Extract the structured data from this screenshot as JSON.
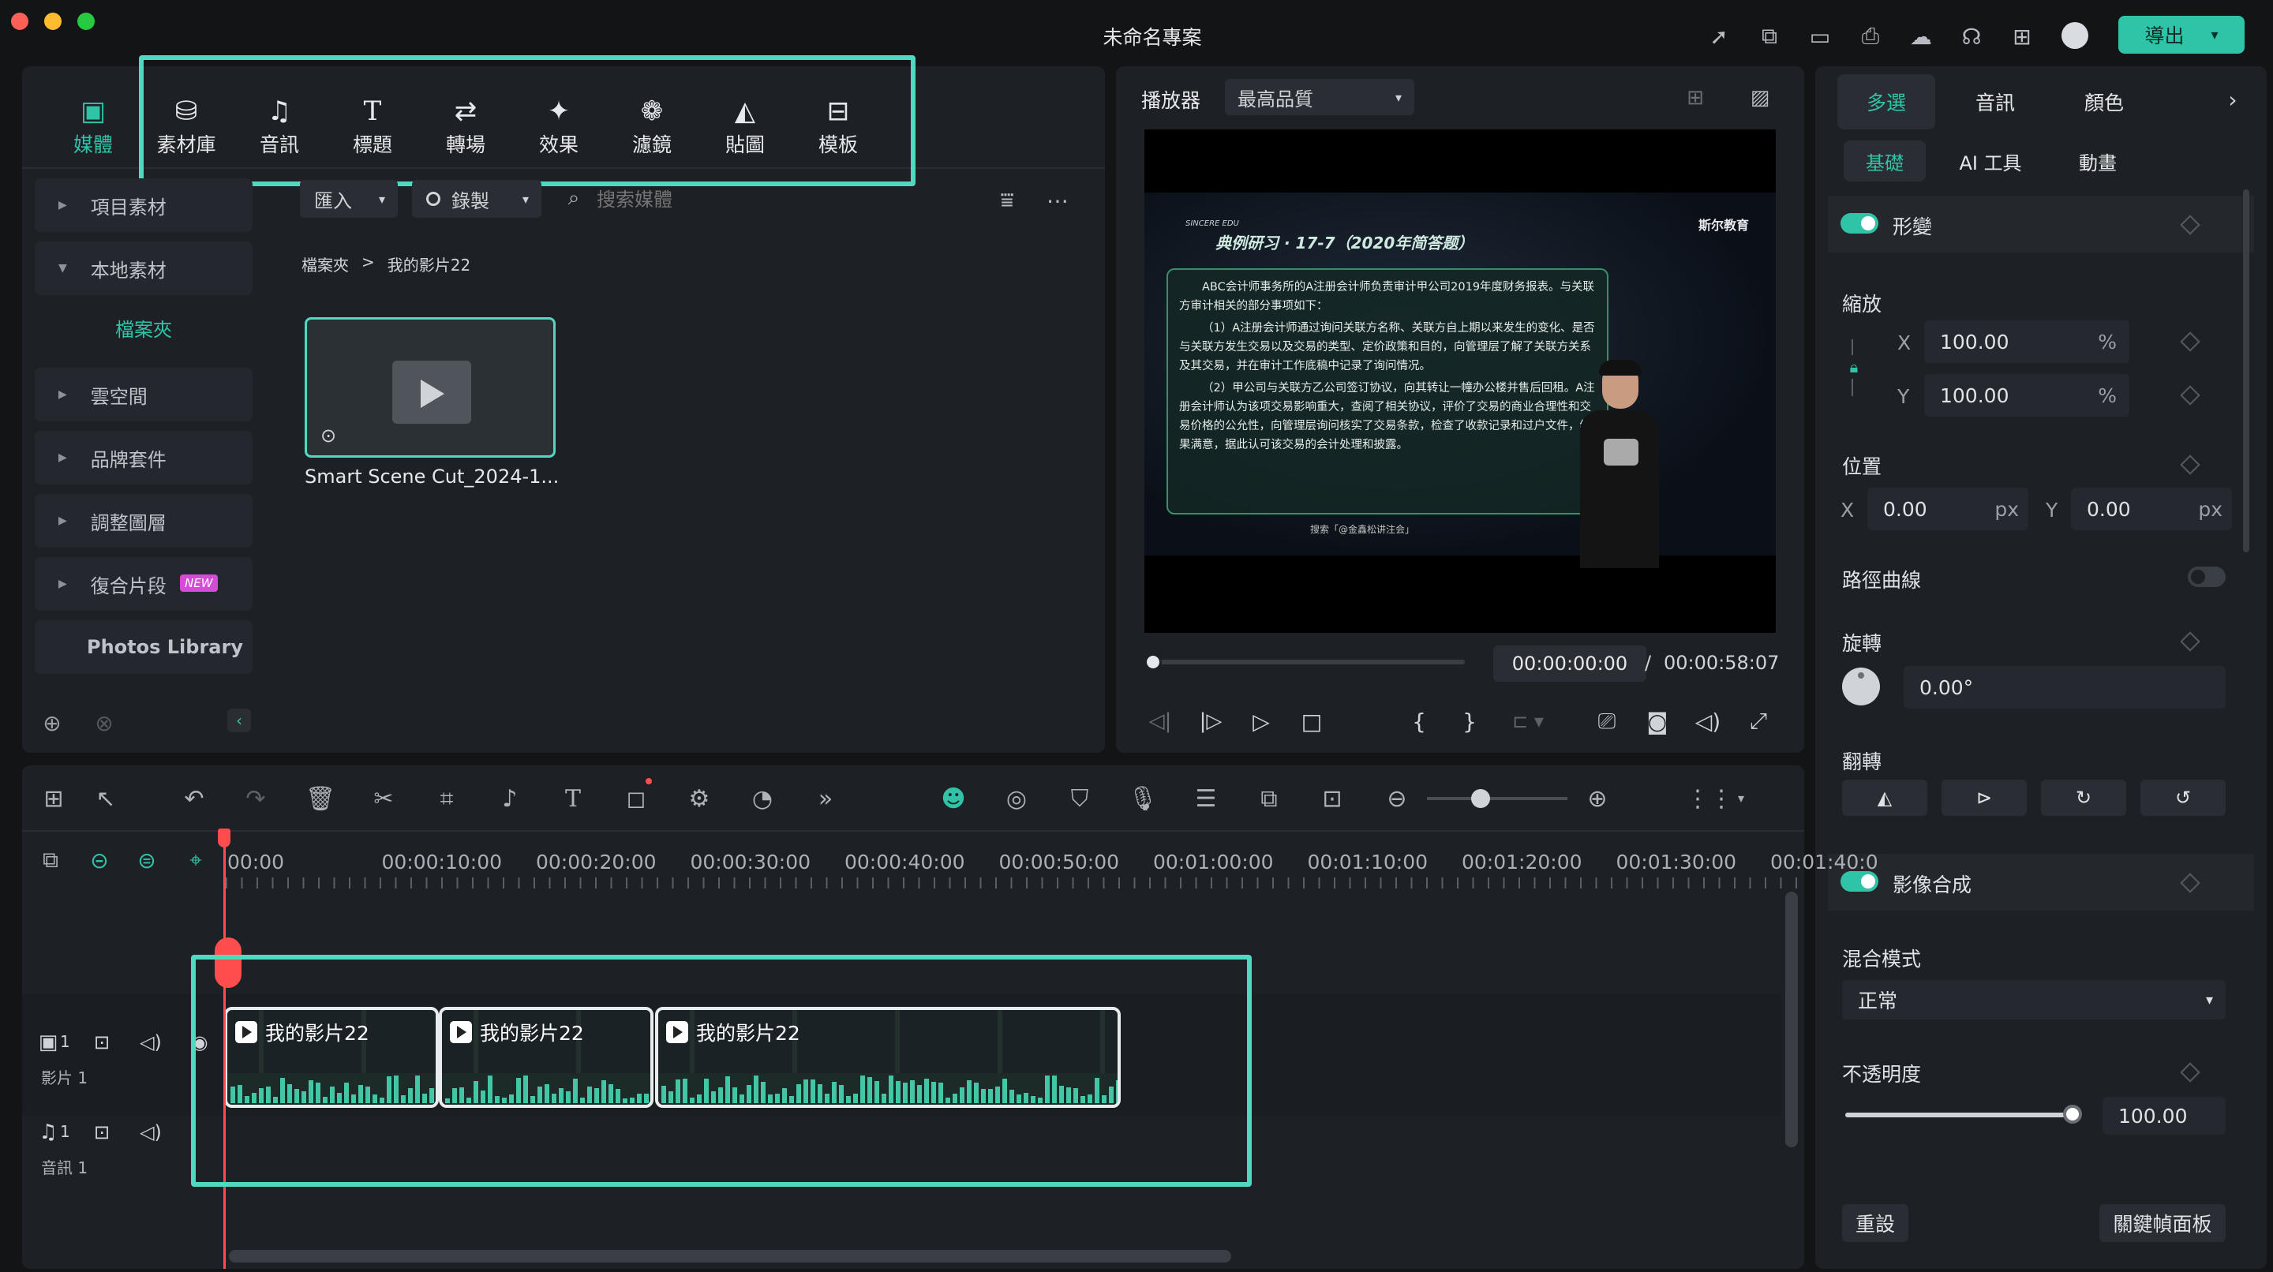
{
  "window": {
    "title": "未命名專案",
    "export_label": "導出"
  },
  "toolbar": {
    "media": "媒體",
    "items": [
      "素材庫",
      "音訊",
      "標題",
      "轉場",
      "效果",
      "濾鏡",
      "貼圖",
      "模板"
    ]
  },
  "sidebar": {
    "items": [
      "項目素材",
      "本地素材",
      "檔案夾",
      "雲空間",
      "品牌套件",
      "調整圖層",
      "復合片段",
      "Photos Library"
    ],
    "new_badge": "NEW"
  },
  "media_bar": {
    "import": "匯入",
    "record": "錄製",
    "search_placeholder": "搜索媒體"
  },
  "breadcrumb": {
    "root": "檔案夾",
    "sep": ">",
    "current": "我的影片22"
  },
  "media_item": {
    "name": "Smart Scene Cut_2024-1..."
  },
  "player": {
    "label": "播放器",
    "quality": "最高品質",
    "current_time": "00:00:00:00",
    "separator": "/",
    "total_time": "00:00:58:07",
    "progress": 0,
    "brackets": [
      "{",
      "}"
    ]
  },
  "video": {
    "brand": "斯尔教育",
    "banner_en": "SINCERE EDU",
    "heading": "典例研习 · 17-7（2020年简答题）",
    "para1": "ABC会计师事务所的A注册会计师负责审计甲公司2019年度财务报表。与关联方审计相关的部分事项如下：",
    "para2": "（1）A注册会计师通过询问关联方名称、关联方自上期以来发生的变化、是否与关联方发生交易以及交易的类型、定价政策和目的，向管理层了解了关联方关系及其交易，并在审计工作底稿中记录了询问情况。",
    "para3": "（2）甲公司与关联方乙公司签订协议，向其转让一幢办公楼并售后回租。A注册会计师认为该项交易影响重大，查阅了相关协议，评价了交易的商业合理性和交易价格的公允性，向管理层询问核实了交易条款，检查了收款记录和过户文件，结果满意，据此认可该交易的会计处理和披露。",
    "footer": "搜索「@金鑫松讲注会」"
  },
  "right_panel": {
    "tabs": [
      "多選",
      "音訊",
      "顏色"
    ],
    "subtabs": [
      "基礎",
      "AI 工具",
      "動畫"
    ],
    "transform": "形變",
    "scale": "縮放",
    "scale_x_label": "X",
    "scale_x": "100.00",
    "scale_y_label": "Y",
    "scale_y": "100.00",
    "percent": "%",
    "position": "位置",
    "pos_x_label": "X",
    "pos_x": "0.00",
    "pos_y_label": "Y",
    "pos_y": "0.00",
    "px": "px",
    "path_curve": "路徑曲線",
    "rotate": "旋轉",
    "rotate_value": "0.00°",
    "flip": "翻轉",
    "compositing": "影像合成",
    "blend_mode": "混合模式",
    "blend_value": "正常",
    "opacity": "不透明度",
    "opacity_value": "100.00",
    "opacity_level": 1.0,
    "reset": "重設",
    "keyframe_panel": "關鍵幀面板"
  },
  "timeline": {
    "ruler": [
      "00:00",
      "00:00:10:00",
      "00:00:20:00",
      "00:00:30:00",
      "00:00:40:00",
      "00:00:50:00",
      "00:01:00:00",
      "00:01:10:00",
      "00:01:20:00",
      "00:01:30:00",
      "00:01:40:0"
    ],
    "video_track_num": "1",
    "video_track_label": "影片 1",
    "audio_track_num": "1",
    "audio_track_label": "音訊 1",
    "clips": [
      "我的影片22",
      "我的影片22",
      "我的影片22"
    ]
  }
}
